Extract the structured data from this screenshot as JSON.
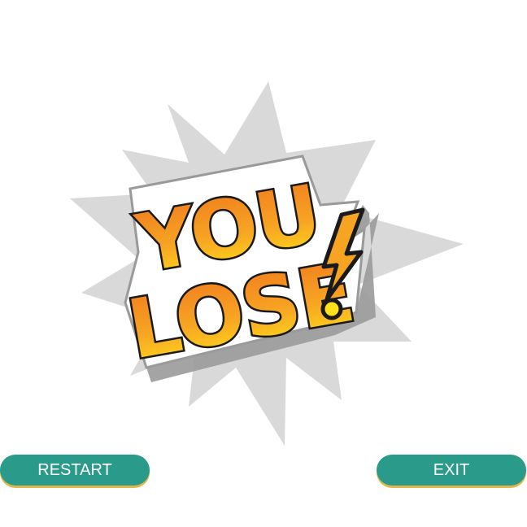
{
  "game_over": {
    "line1": "YOU",
    "line2": "LOSE",
    "mark": "!"
  },
  "buttons": {
    "restart_label": "RESTART",
    "exit_label": "EXIT"
  },
  "colors": {
    "button": "#2a9a8a",
    "button_shadow": "#e0b84a",
    "burst": "#d9d9d9",
    "text_top": "#f07a1e",
    "text_bottom": "#ffe01a",
    "outline": "#1a1a1a"
  },
  "icons": {
    "burst": "comic-explosion-icon"
  }
}
